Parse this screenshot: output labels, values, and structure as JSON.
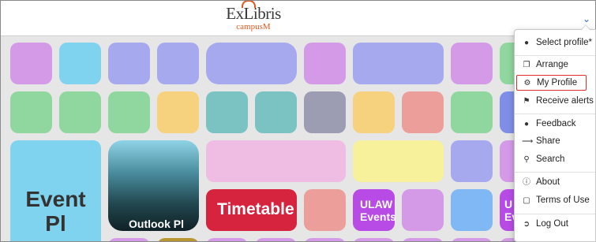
{
  "header": {
    "logo_main": "ExLibris",
    "logo_sub": "campusM",
    "menu_toggle_icon": "chevron-down-icon"
  },
  "tiles": {
    "event": {
      "line1": "Event",
      "line2": "Pl",
      "bg": "#7fd3ef"
    },
    "outlook": {
      "label": "Outlook Pl"
    },
    "timetable": {
      "label": "Timetable",
      "bg": "#d6243f"
    },
    "ulaw": {
      "line1": "ULAW",
      "line2": "Events",
      "bg": "#b84be6"
    },
    "cut": {
      "line1": "U",
      "line2": "Ev"
    }
  },
  "menu": {
    "items": [
      {
        "label": "Select profile*",
        "icon": "user-icon"
      },
      {
        "label": "Arrange",
        "icon": "copy-icon"
      },
      {
        "label": "My Profile",
        "icon": "gear-icon",
        "highlighted": true
      },
      {
        "label": "Receive alerts",
        "icon": "megaphone-icon"
      },
      {
        "label": "Feedback",
        "icon": "comment-icon"
      },
      {
        "label": "Share",
        "icon": "share-icon"
      },
      {
        "label": "Search",
        "icon": "search-icon"
      },
      {
        "label": "About",
        "icon": "info-icon"
      },
      {
        "label": "Terms of Use",
        "icon": "document-icon"
      },
      {
        "label": "Log Out",
        "icon": "logout-icon"
      }
    ]
  },
  "colors": {
    "highlight_border": "#e02b2b",
    "accent_orange": "#e4571e",
    "link_blue": "#2e6fc7"
  }
}
